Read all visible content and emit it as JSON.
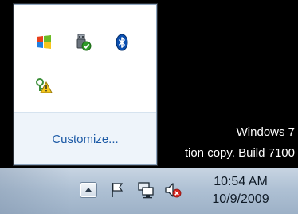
{
  "flyout": {
    "icons": [
      {
        "icon": "windows-logo-icon"
      },
      {
        "icon": "usb-device-check-icon"
      },
      {
        "icon": "bluetooth-icon"
      },
      {
        "icon": "network-key-warning-icon"
      }
    ],
    "customize_label": "Customize..."
  },
  "desktop": {
    "watermark_line1": "Windows 7",
    "watermark_line2": "tion copy. Build 7100"
  },
  "taskbar": {
    "tray_icons": [
      {
        "icon": "show-hidden-icons-arrow-icon"
      },
      {
        "icon": "action-center-flag-icon"
      },
      {
        "icon": "network-icon"
      },
      {
        "icon": "volume-muted-icon"
      }
    ],
    "clock": {
      "time": "10:54 AM",
      "date": "10/9/2009"
    }
  },
  "colors": {
    "link": "#1c5aa6",
    "taskbar": "#afc1d4",
    "flyout_footer": "#eef4fa"
  }
}
